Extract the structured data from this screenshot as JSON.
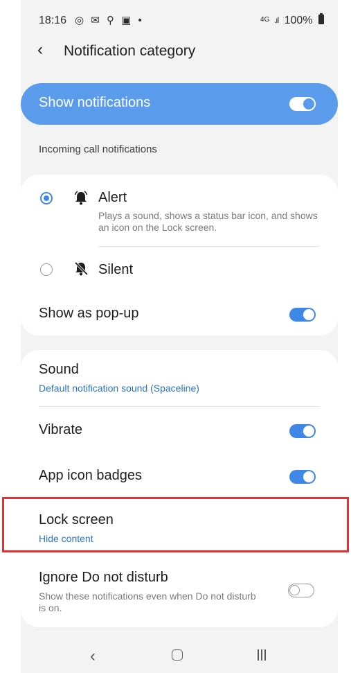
{
  "status_bar": {
    "time": "18:16",
    "icons": "◎ ✉ ⚲ ▣ •",
    "network": "4G",
    "battery": "100%"
  },
  "header": {
    "title": "Notification category"
  },
  "master_toggle": {
    "label": "Show notifications",
    "on": true
  },
  "section_label": "Incoming call notifications",
  "alert_card": {
    "alert": {
      "title": "Alert",
      "description": "Plays a sound, shows a status bar icon, and shows an icon on the Lock screen.",
      "selected": true
    },
    "silent": {
      "title": "Silent",
      "selected": false
    },
    "popup": {
      "title": "Show as pop-up",
      "on": true
    }
  },
  "settings_card": {
    "sound": {
      "title": "Sound",
      "value": "Default notification sound (Spaceline)"
    },
    "vibrate": {
      "title": "Vibrate",
      "on": true
    },
    "badges": {
      "title": "App icon badges",
      "on": true
    },
    "lock_screen": {
      "title": "Lock screen",
      "value": "Hide content"
    },
    "dnd": {
      "title": "Ignore Do not disturb",
      "description": "Show these notifications even when Do not disturb is on.",
      "on": false
    }
  },
  "colors": {
    "accent": "#3e87e6",
    "master_bg": "#5b9bec",
    "link": "#2a75c9",
    "highlight": "#e03232"
  }
}
